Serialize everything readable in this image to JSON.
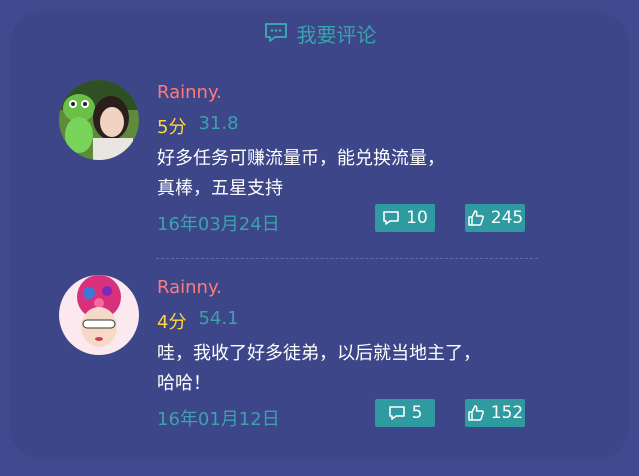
{
  "header": {
    "title": "我要评论",
    "icon": "comment-icon"
  },
  "comments": [
    {
      "name": "Rainny.",
      "score": "5分",
      "value": "31.8",
      "text_line1": "好多任务可赚流量币，能兑换流量，",
      "text_line2": "真棒，五星支持",
      "date": "16年03月24日",
      "reply_count": "10",
      "like_count": "245"
    },
    {
      "name": "Rainny.",
      "score": "4分",
      "value": "54.1",
      "text_line1": "哇，我收了好多徒弟，以后就当地主了，",
      "text_line2": "哈哈！",
      "date": "16年01月12日",
      "reply_count": "5",
      "like_count": "152"
    }
  ],
  "colors": {
    "background": "#3f4a8f",
    "card": "#3c4689",
    "accent": "#3aa3ac",
    "name": "#ff7b7b",
    "score": "#ffd63a",
    "button": "#2f9aa0"
  }
}
